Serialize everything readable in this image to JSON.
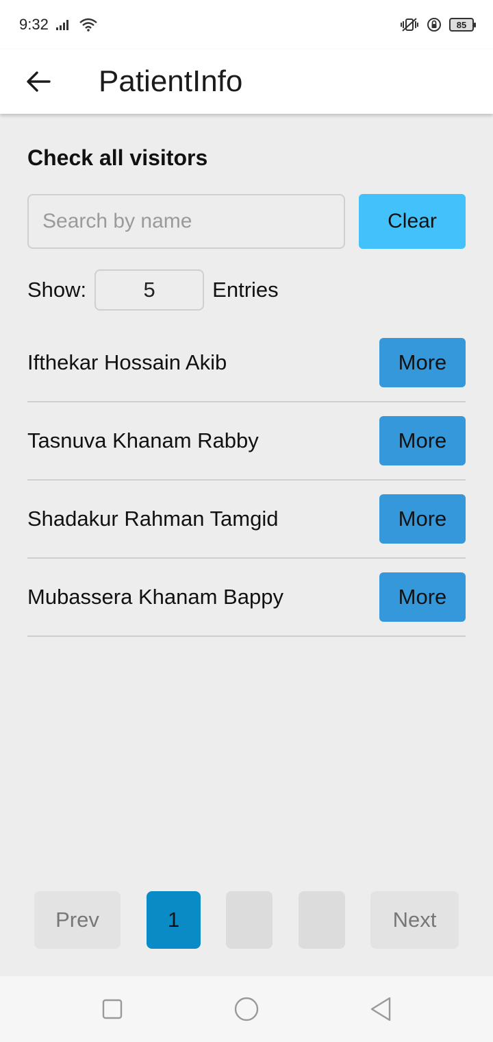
{
  "status_bar": {
    "time": "9:32",
    "battery": "85",
    "icons": [
      "signal-icon",
      "wifi-icon",
      "vibrate-icon",
      "rotation-lock-icon",
      "battery-icon"
    ]
  },
  "app_bar": {
    "title": "PatientInfo",
    "back_icon": "back-arrow-icon"
  },
  "main": {
    "heading": "Check all visitors",
    "search": {
      "placeholder": "Search by name",
      "value": ""
    },
    "clear_label": "Clear",
    "show_label": "Show:",
    "entries_value": "5",
    "entries_label": "Entries",
    "visitors": [
      {
        "name": "Ifthekar Hossain Akib",
        "action": "More"
      },
      {
        "name": "Tasnuva Khanam Rabby",
        "action": "More"
      },
      {
        "name": "Shadakur Rahman Tamgid",
        "action": "More"
      },
      {
        "name": "Mubassera Khanam Bappy",
        "action": "More"
      }
    ]
  },
  "pagination": {
    "prev_label": "Prev",
    "pages": [
      "1",
      "",
      ""
    ],
    "next_label": "Next",
    "active_color": "#0a8bc6"
  },
  "colors": {
    "clear_button": "#42c1fb",
    "more_button": "#3498db",
    "background": "#ededed"
  },
  "nav_bar": {
    "icons": [
      "recent-apps-icon",
      "home-icon",
      "back-icon"
    ]
  }
}
